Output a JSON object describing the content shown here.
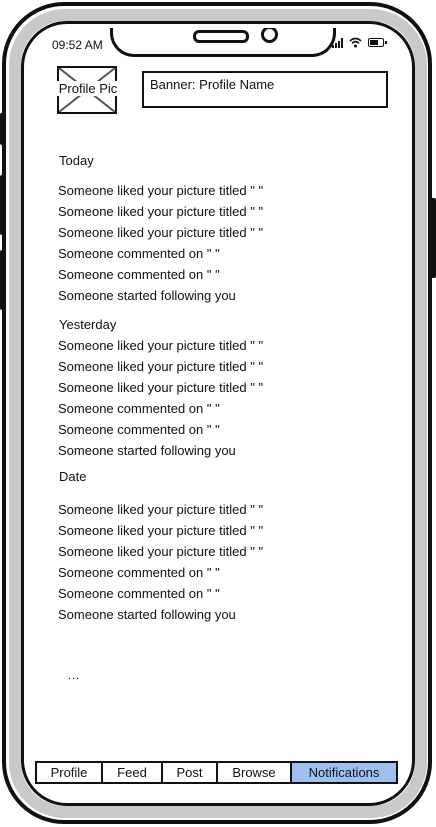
{
  "status_bar": {
    "time": "09:52 AM"
  },
  "header": {
    "profile_pic_label": "Profile Pic",
    "banner_label": "Banner: Profile Name"
  },
  "sections": [
    {
      "title": "Today",
      "items": [
        "Someone liked your picture titled \" \"",
        "Someone liked your picture titled \" \"",
        "Someone liked your picture titled \" \"",
        "Someone commented on \" \"",
        "Someone commented on \" \"",
        "Someone started following you"
      ]
    },
    {
      "title": "Yesterday",
      "items": [
        "Someone liked your picture titled \" \"",
        "Someone liked your picture titled \" \"",
        "Someone liked your picture titled \" \"",
        "Someone commented on \" \"",
        "Someone commented on \" \"",
        "Someone started following you"
      ]
    },
    {
      "title": "Date",
      "items": [
        "Someone liked your picture titled \" \"",
        "Someone liked your picture titled \" \"",
        "Someone liked your picture titled \" \"",
        "Someone commented on \" \"",
        "Someone commented on \" \"",
        "Someone started following you"
      ]
    }
  ],
  "more_indicator": "...",
  "tabs": [
    {
      "label": "Profile",
      "active": false
    },
    {
      "label": "Feed",
      "active": false
    },
    {
      "label": "Post",
      "active": false
    },
    {
      "label": "Browse",
      "active": false
    },
    {
      "label": "Notifications",
      "active": true
    }
  ],
  "colors": {
    "active_tab": "#9fbfef",
    "frame": "#c9c9c9"
  }
}
